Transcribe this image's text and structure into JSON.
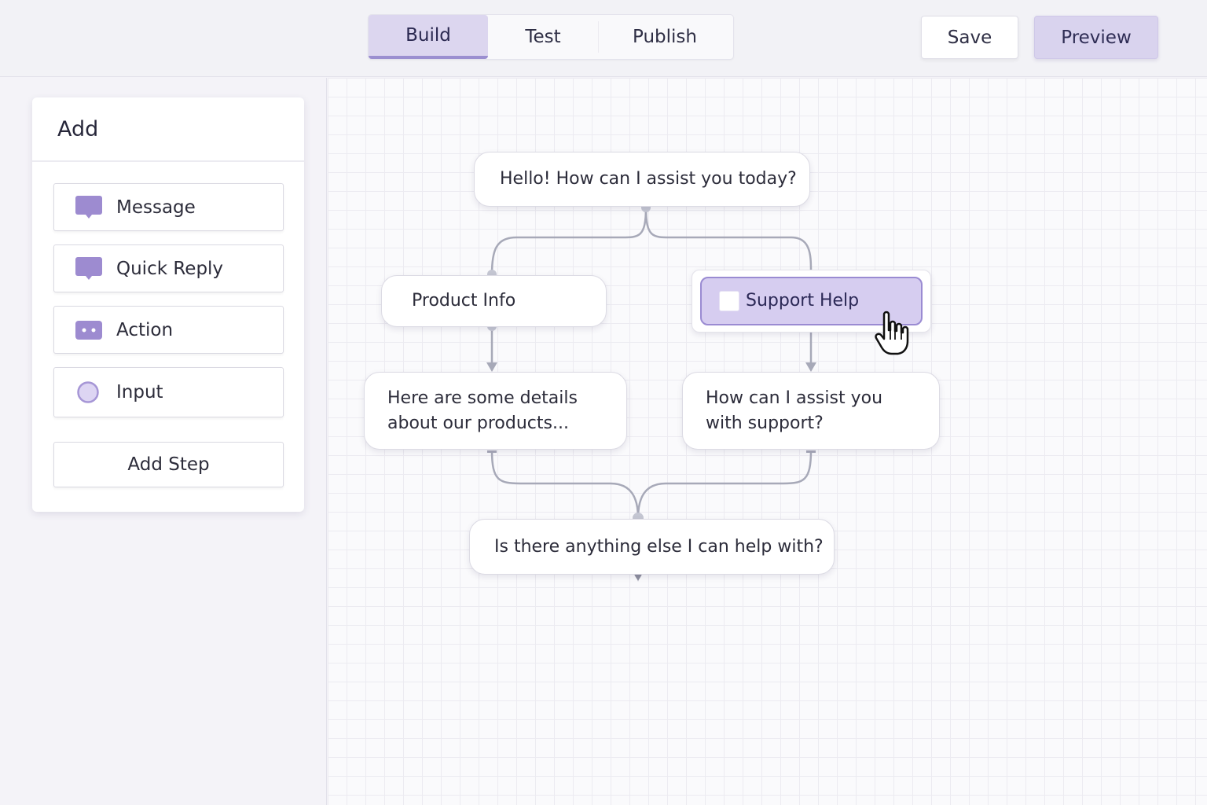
{
  "header": {
    "tabs": [
      {
        "label": "Build",
        "active": true
      },
      {
        "label": "Test",
        "active": false
      },
      {
        "label": "Publish",
        "active": false
      }
    ],
    "save_label": "Save",
    "preview_label": "Preview"
  },
  "add_panel": {
    "title": "Add",
    "items": [
      {
        "label": "Message",
        "icon": "message-icon"
      },
      {
        "label": "Quick Reply",
        "icon": "quick-reply-icon"
      },
      {
        "label": "Action",
        "icon": "action-icon"
      },
      {
        "label": "Input",
        "icon": "input-icon"
      }
    ],
    "add_step_label": "Add Step"
  },
  "flow": {
    "greeting": "Hello! How can I assist you today?",
    "product_info": "Product Info",
    "support_help": "Support Help",
    "product_details_line1": "Here are some details",
    "product_details_line2": "about our products...",
    "support_question_line1": "How can I assist you",
    "support_question_line2": "with support?",
    "closing": "Is there anything else I can help with?"
  },
  "colors": {
    "accent": "#9b8fd0",
    "accent_light": "#dcd6ef",
    "icon_purple": "#9d8bd0",
    "connector": "#a7a9b8"
  }
}
